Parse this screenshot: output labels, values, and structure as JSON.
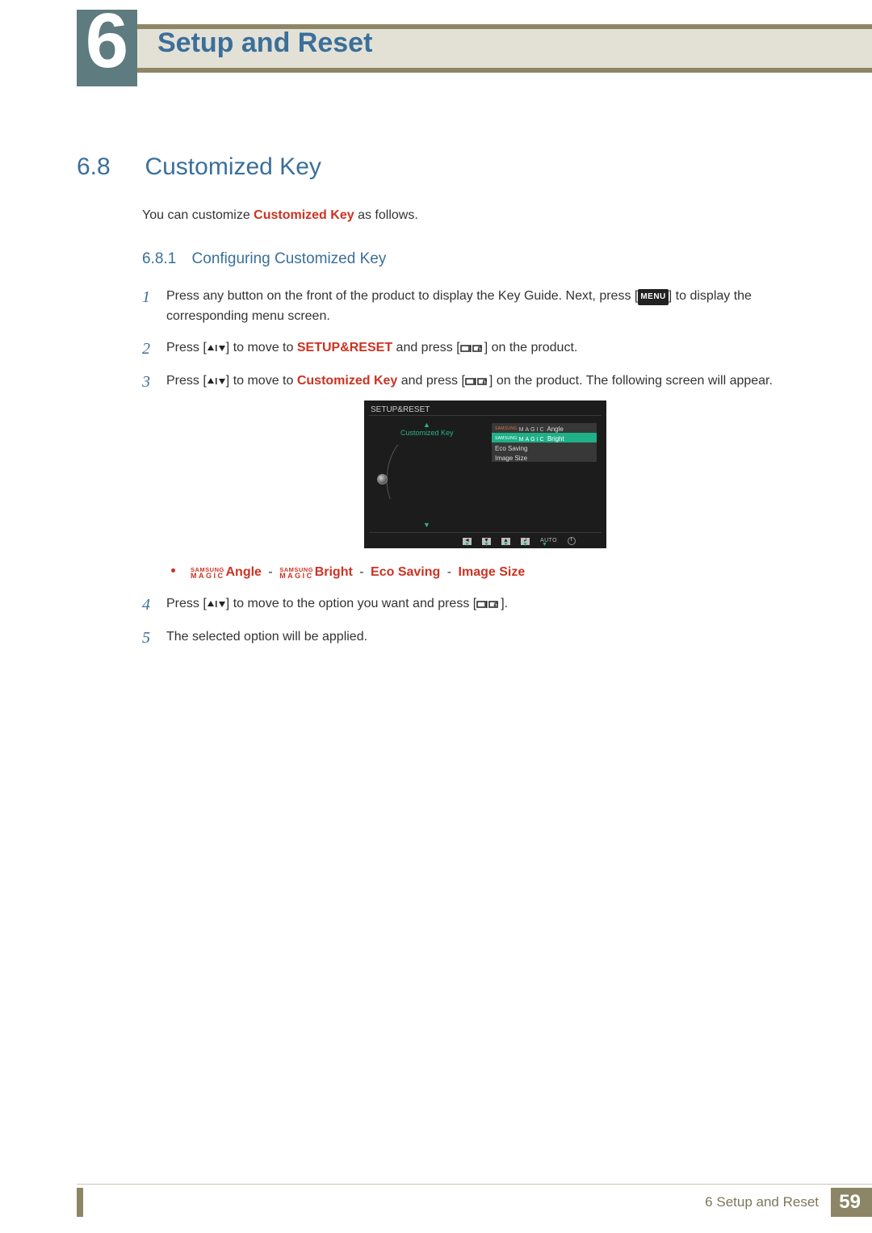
{
  "chapter": {
    "number": "6",
    "title": "Setup and Reset"
  },
  "section": {
    "number": "6.8",
    "title": "Customized Key"
  },
  "intro": {
    "pre": "You can customize ",
    "bold": "Customized Key",
    "post": " as follows."
  },
  "subsection": {
    "number": "6.8.1",
    "title": "Configuring Customized Key"
  },
  "steps": {
    "s1": {
      "num": "1",
      "a": "Press any button on the front of the product to display the Key Guide. Next, press [",
      "menu": "MENU",
      "b": "] to display the corresponding menu screen."
    },
    "s2": {
      "num": "2",
      "a": "Press [",
      "b": "] to move to ",
      "target": "SETUP&RESET",
      "c": " and press [",
      "d": "] on the product."
    },
    "s3": {
      "num": "3",
      "a": "Press [",
      "b": "] to move to ",
      "target": "Customized Key",
      "c": " and press [",
      "d": "] on the product. The following screen will appear."
    },
    "s4": {
      "num": "4",
      "a": "Press [",
      "b": "] to move to the option you want and press [",
      "c": "]."
    },
    "s5": {
      "num": "5",
      "text": "The selected option will be applied."
    }
  },
  "osd": {
    "title": "SETUP&RESET",
    "key_label": "Customized Key",
    "options": {
      "angle_prefix_a": "SAMSUNG",
      "angle_prefix_b": "MAGIC",
      "angle": "Angle",
      "bright_prefix_a": "SAMSUNG",
      "bright_prefix_b": "MAGIC",
      "bright": "Bright",
      "eco": "Eco Saving",
      "size": "Image Size"
    },
    "auto": "AUTO"
  },
  "bullet": {
    "magic_small": "SAMSUNG",
    "magic_big": "MAGIC",
    "angle": "Angle",
    "bright": "Bright",
    "eco": "Eco Saving",
    "image": "Image Size"
  },
  "footer": {
    "chapter_label": "6 Setup and Reset",
    "page": "59"
  }
}
